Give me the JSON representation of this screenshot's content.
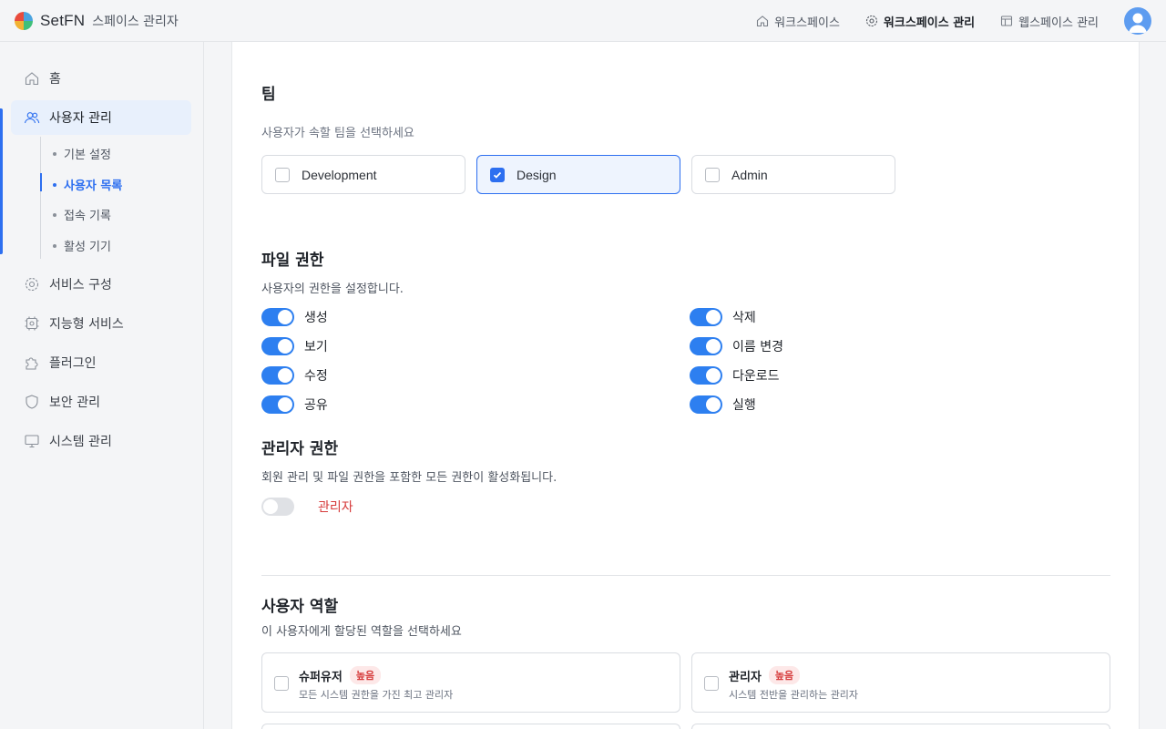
{
  "app": {
    "brand": "SetFN",
    "subtitle": "스페이스 관리자",
    "colors": {
      "accent": "#2d6ff0",
      "danger": "#d63b3b"
    }
  },
  "topnav": {
    "items": [
      {
        "label": "워크스페이스",
        "icon": "home-icon",
        "active": false
      },
      {
        "label": "워크스페이스 관리",
        "icon": "gear-icon",
        "active": true
      },
      {
        "label": "웹스페이스 관리",
        "icon": "layout-icon",
        "active": false
      }
    ]
  },
  "sidebar": {
    "items": [
      {
        "label": "홈",
        "icon": "home-icon"
      },
      {
        "label": "사용자 관리",
        "icon": "users-icon"
      },
      {
        "label": "서비스 구성",
        "icon": "gear-icon"
      },
      {
        "label": "지능형 서비스",
        "icon": "chip-icon"
      },
      {
        "label": "플러그인",
        "icon": "puzzle-icon"
      },
      {
        "label": "보안 관리",
        "icon": "shield-icon"
      },
      {
        "label": "시스템 관리",
        "icon": "monitor-icon"
      }
    ],
    "sub_items": [
      {
        "label": "기본 설정"
      },
      {
        "label": "사용자 목록"
      },
      {
        "label": "접속 기록"
      },
      {
        "label": "활성 기기"
      }
    ]
  },
  "team": {
    "title": "팀",
    "description": "사용자가 속할 팀을 선택하세요",
    "options": [
      {
        "label": "Development",
        "checked": false
      },
      {
        "label": "Design",
        "checked": true
      },
      {
        "label": "Admin",
        "checked": false
      }
    ]
  },
  "file_permissions": {
    "title": "파일 권한",
    "description": "사용자의 권한을 설정합니다.",
    "items": [
      {
        "label": "생성",
        "enabled": true
      },
      {
        "label": "보기",
        "enabled": true
      },
      {
        "label": "수정",
        "enabled": true
      },
      {
        "label": "공유",
        "enabled": true
      },
      {
        "label": "삭제",
        "enabled": true
      },
      {
        "label": "이름 변경",
        "enabled": true
      },
      {
        "label": "다운로드",
        "enabled": true
      },
      {
        "label": "실행",
        "enabled": true
      }
    ]
  },
  "admin_permissions": {
    "title": "관리자 권한",
    "description": "회원 관리 및 파일 권한을 포함한 모든 권한이 활성화됩니다.",
    "toggle_label": "관리자",
    "enabled": false
  },
  "user_roles": {
    "title": "사용자 역할",
    "description": "이 사용자에게 할당된 역할을 선택하세요",
    "roles": [
      {
        "name": "슈퍼유저",
        "badge": "높음",
        "description": "모든 시스템 권한을 가진 최고 관리자",
        "checked": false
      },
      {
        "name": "관리자",
        "badge": "높음",
        "description": "시스템 전반을 관리하는 관리자",
        "checked": false
      }
    ]
  }
}
